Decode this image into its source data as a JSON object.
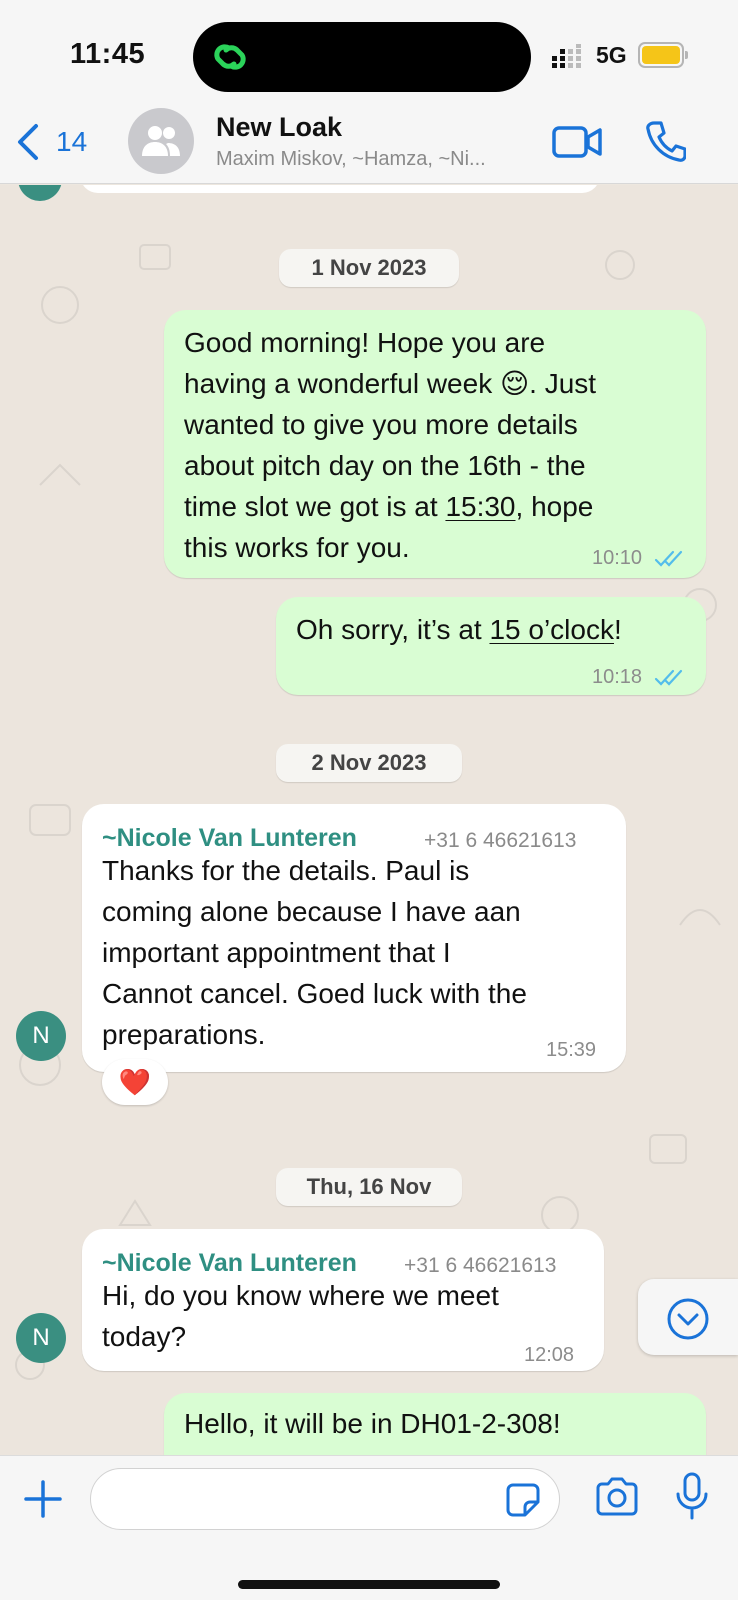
{
  "status_bar": {
    "time": "11:45",
    "network": "5G"
  },
  "header": {
    "back_count": "14",
    "title": "New Loak",
    "subtitle": "Maxim Miskov, ~Hamza, ~Ni..."
  },
  "date_chips": [
    "1 Nov 2023",
    "2 Nov 2023",
    "Thu, 16 Nov"
  ],
  "messages": [
    {
      "type": "outgoing",
      "lines": [
        "Good morning! Hope you are",
        "having a wonderful week 😌. Just",
        "wanted to give you more details",
        "about pitch day on the 16th - the"
      ],
      "line5_pre": "time slot we got is at ",
      "line5_link": "15:30",
      "line5_post": ", hope",
      "line6": "this works for you.",
      "time": "10:10"
    },
    {
      "type": "outgoing",
      "pre": "Oh sorry, it’s at ",
      "link": "15 o’clock",
      "post": "!",
      "time": "10:18"
    },
    {
      "type": "incoming",
      "sender": "~Nicole Van Lunteren",
      "phone": "+31 6 46621613",
      "lines": [
        "Thanks for the details. Paul is",
        "coming alone because I have aan",
        "important appointment that I",
        "Cannot cancel. Goed luck with the",
        "preparations."
      ],
      "time": "15:39",
      "reaction": "❤️",
      "avatar_initial": "N"
    },
    {
      "type": "incoming",
      "sender": "~Nicole Van Lunteren",
      "phone": "+31 6 46621613",
      "lines": [
        "Hi, do you know where we meet",
        "today?"
      ],
      "time": "12:08",
      "avatar_initial": "N"
    },
    {
      "type": "outgoing",
      "partial": "Hello, it will be in DH01-2-308!"
    }
  ],
  "input": {
    "placeholder": ""
  },
  "colors": {
    "accent": "#1a73d8",
    "outgoing_bubble": "#d9fdd3",
    "incoming_bubble": "#ffffff",
    "sender_name": "#2f8f82",
    "read_ticks": "#53bdeb"
  }
}
